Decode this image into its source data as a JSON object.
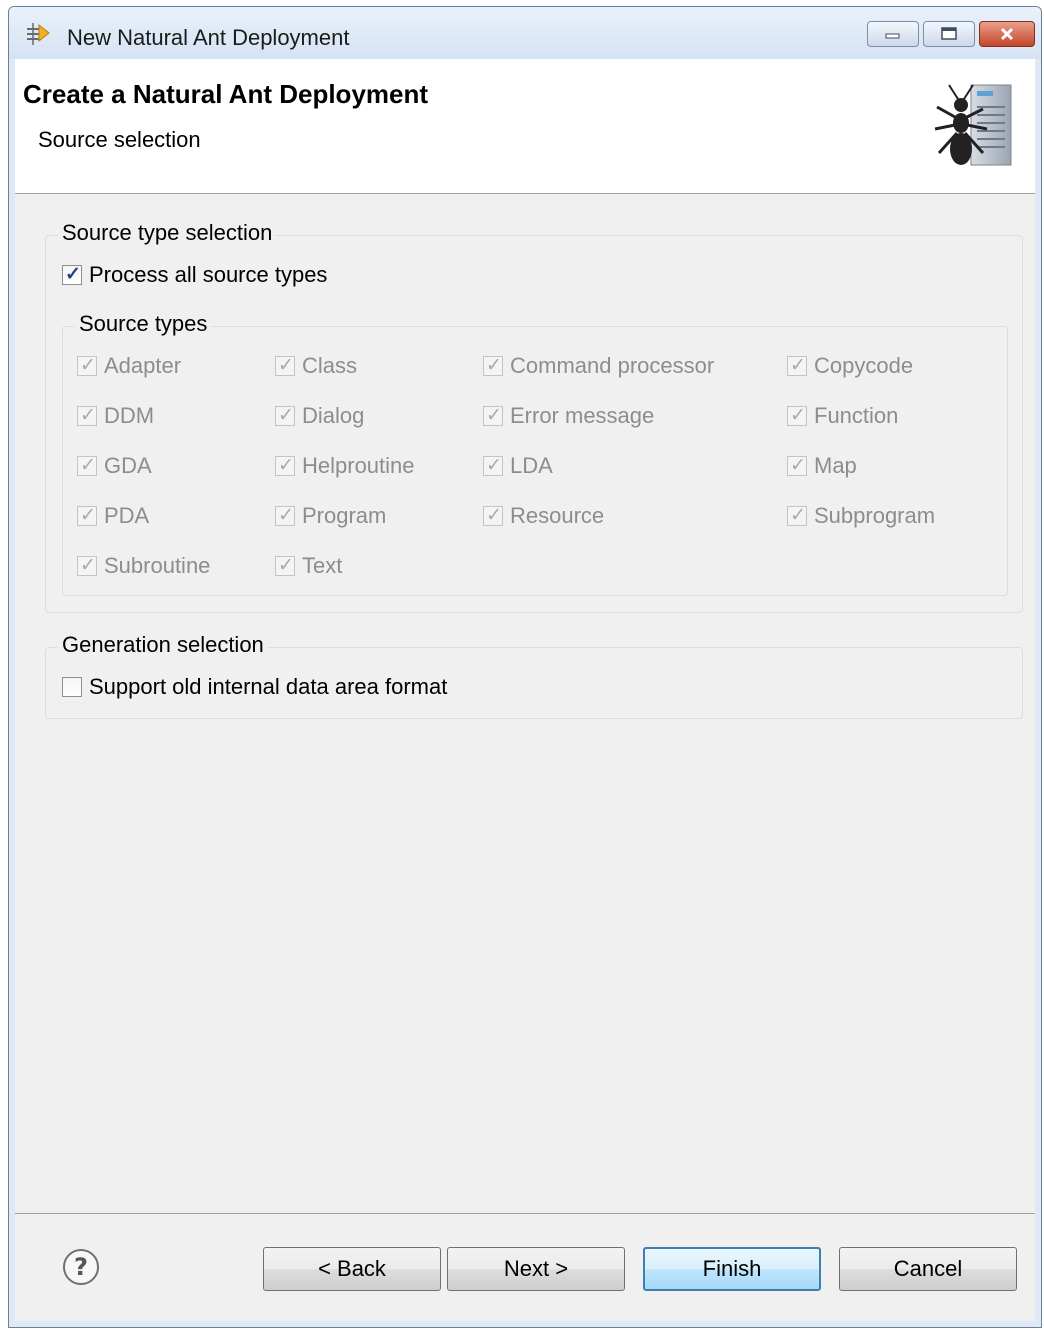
{
  "window": {
    "title": "New Natural Ant Deployment"
  },
  "banner": {
    "title": "Create a Natural Ant Deployment",
    "subtitle": "Source selection",
    "icon": "ant-server-icon"
  },
  "source_type_selection": {
    "group_label": "Source type selection",
    "process_all": {
      "label": "Process all source types",
      "checked": true
    }
  },
  "source_types": {
    "group_label": "Source types",
    "items": [
      {
        "label": "Adapter",
        "checked": true
      },
      {
        "label": "Class",
        "checked": true
      },
      {
        "label": "Command processor",
        "checked": true
      },
      {
        "label": "Copycode",
        "checked": true
      },
      {
        "label": "DDM",
        "checked": true
      },
      {
        "label": "Dialog",
        "checked": true
      },
      {
        "label": "Error message",
        "checked": true
      },
      {
        "label": "Function",
        "checked": true
      },
      {
        "label": "GDA",
        "checked": true
      },
      {
        "label": "Helproutine",
        "checked": true
      },
      {
        "label": "LDA",
        "checked": true
      },
      {
        "label": "Map",
        "checked": true
      },
      {
        "label": "PDA",
        "checked": true
      },
      {
        "label": "Program",
        "checked": true
      },
      {
        "label": "Resource",
        "checked": true
      },
      {
        "label": "Subprogram",
        "checked": true
      },
      {
        "label": "Subroutine",
        "checked": true
      },
      {
        "label": "Text",
        "checked": true
      }
    ]
  },
  "generation_selection": {
    "group_label": "Generation selection",
    "old_format": {
      "label": "Support old internal data area format",
      "checked": false
    }
  },
  "footer": {
    "help_icon": "question-mark-icon",
    "back": "< Back",
    "next": "Next >",
    "finish": "Finish",
    "cancel": "Cancel"
  }
}
